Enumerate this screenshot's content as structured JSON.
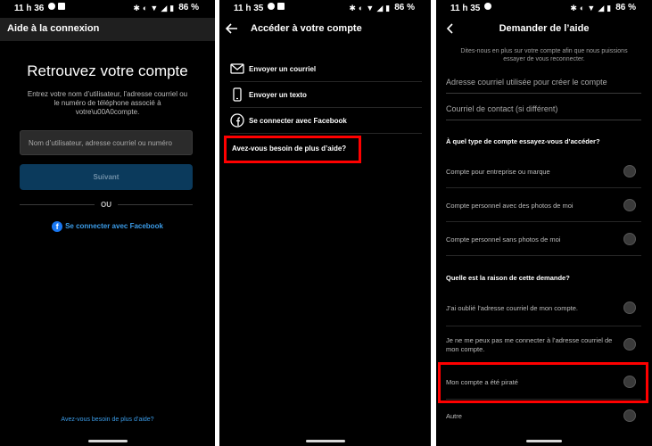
{
  "status": {
    "p1_time": "11 h 36",
    "p2_time": "11 h 35",
    "p3_time": "11 h 35",
    "battery": "86 %"
  },
  "screen1": {
    "header_title": "Aide à la connexion",
    "heading": "Retrouvez votre compte",
    "description": "Entrez votre nom d’utilisateur, l’adresse courriel ou le numéro de téléphone associé à votre\\u00A0compte.",
    "input_placeholder": "Nom d’utilisateur, adresse courriel ou numéro",
    "next_button": "Suivant",
    "or_text": "OU",
    "facebook_link": "Se connecter avec Facebook",
    "help_link": "Avez-vous besoin de plus d’aide?"
  },
  "screen2": {
    "header_title": "Accéder à votre compte",
    "items": [
      {
        "label": "Envoyer un courriel",
        "icon": "mail-icon"
      },
      {
        "label": "Envoyer un texto",
        "icon": "phone-icon"
      },
      {
        "label": "Se connecter avec Facebook",
        "icon": "facebook-icon"
      }
    ],
    "help_item": "Avez-vous besoin de plus d’aide?"
  },
  "screen3": {
    "header_title": "Demander de l’aide",
    "intro": "Dites-nous en plus sur votre compte afin que nous puissions essayer de vous reconnecter.",
    "field_email": "Adresse courriel utilisée pour créer le compte",
    "field_contact": "Courriel de contact (si différent)",
    "question_type": "À quel type de compte essayez-vous d’accéder?",
    "account_types": [
      "Compte pour entreprise ou marque",
      "Compte personnel avec des photos de moi",
      "Compte personnel sans photos de moi"
    ],
    "question_reason": "Quelle est la raison de cette demande?",
    "reasons": [
      "J’ai oublié l’adresse courriel de mon compte.",
      "Je ne me peux pas me connecter à l’adresse courriel de mon compte.",
      "Mon compte a été piraté",
      "Autre"
    ]
  },
  "colors": {
    "background": "#000000",
    "link_blue": "#3b9ce8",
    "button_blue": "#0b3a5c",
    "highlight_red": "#ff0000"
  }
}
